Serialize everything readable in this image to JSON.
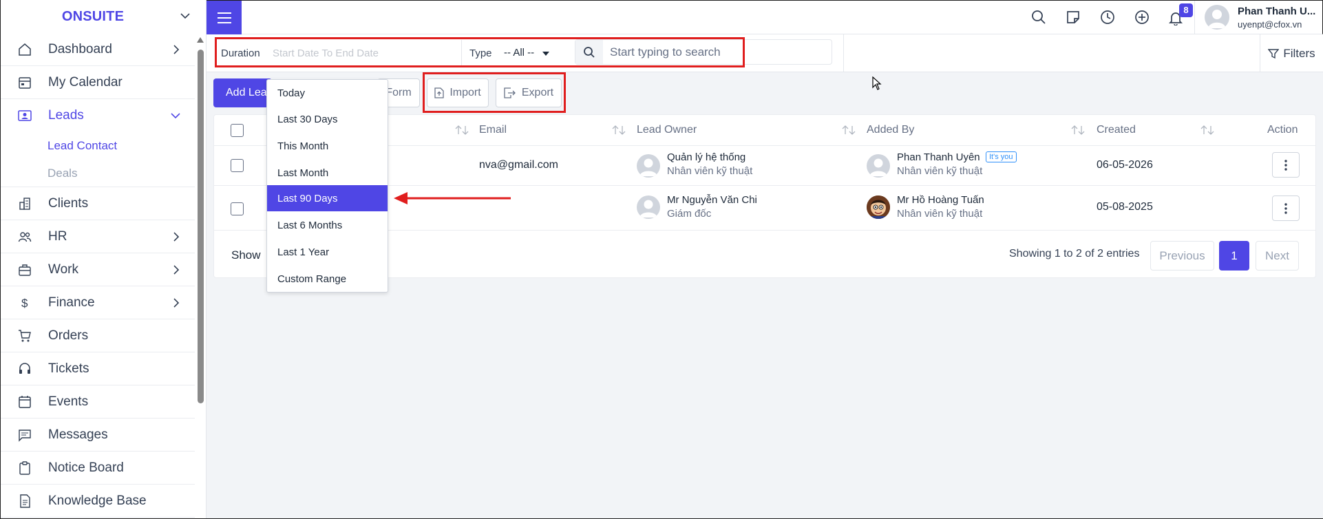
{
  "brand": {
    "name": "ONSUITE"
  },
  "sidebar": {
    "items": [
      {
        "label": "Dashboard",
        "icon": "home-icon",
        "has_arrow": true
      },
      {
        "label": "My Calendar",
        "icon": "calendar-icon",
        "has_arrow": false
      },
      {
        "label": "Leads",
        "icon": "leads-icon",
        "expanded": true
      },
      {
        "label": "Clients",
        "icon": "building-icon",
        "has_arrow": false
      },
      {
        "label": "HR",
        "icon": "people-icon",
        "has_arrow": true
      },
      {
        "label": "Work",
        "icon": "briefcase-icon",
        "has_arrow": true
      },
      {
        "label": "Finance",
        "icon": "dollar-icon",
        "has_arrow": true
      },
      {
        "label": "Orders",
        "icon": "cart-icon",
        "has_arrow": false
      },
      {
        "label": "Tickets",
        "icon": "headset-icon",
        "has_arrow": false
      },
      {
        "label": "Events",
        "icon": "event-icon",
        "has_arrow": false
      },
      {
        "label": "Messages",
        "icon": "message-icon",
        "has_arrow": false
      },
      {
        "label": "Notice Board",
        "icon": "clipboard-icon",
        "has_arrow": false
      },
      {
        "label": "Knowledge Base",
        "icon": "document-icon",
        "has_arrow": false
      }
    ],
    "leads_sub": [
      {
        "label": "Lead Contact",
        "active": true
      },
      {
        "label": "Deals",
        "active": false
      }
    ]
  },
  "topbar": {
    "notification_count": "8",
    "user_name": "Phan Thanh U...",
    "user_email": "uyenpt@cfox.vn"
  },
  "filters": {
    "duration_label": "Duration",
    "date_placeholder": "Start Date To End Date",
    "type_label": "Type",
    "type_value": "-- All --",
    "search_placeholder": "Start typing to search",
    "filters_label": "Filters"
  },
  "actions": {
    "add_label": "Add Lead",
    "form_label": "Form",
    "import_label": "Import",
    "export_label": "Export"
  },
  "table": {
    "columns": [
      "Email",
      "Lead Owner",
      "Added By",
      "Created",
      "Action"
    ],
    "rows": [
      {
        "email": "nva@gmail.com",
        "owner_name": "Quản lý hệ thống",
        "owner_role": "Nhân viên kỹ thuật",
        "added_name": "Phan Thanh Uyên",
        "added_badge": "It's you",
        "added_role": "Nhân viên kỹ thuật",
        "created": "06-05-2026"
      },
      {
        "email": "",
        "owner_name": "Mr Nguyễn Văn Chi",
        "owner_role": "Giám đốc",
        "added_name": "Mr Hồ Hoàng Tuấn",
        "added_badge": "",
        "added_role": "Nhân viên kỹ thuật",
        "created": "05-08-2025"
      }
    ],
    "show_label": "Show",
    "showing_text": "Showing 1 to 2 of 2 entries",
    "pagination": {
      "previous": "Previous",
      "current": "1",
      "next": "Next"
    }
  },
  "duration_dropdown": {
    "options": [
      "Today",
      "Last 30 Days",
      "This Month",
      "Last Month",
      "Last 90 Days",
      "Last 6 Months",
      "Last 1 Year",
      "Custom Range"
    ],
    "selected": "Last 90 Days"
  },
  "colors": {
    "accent": "#4f46e5",
    "highlight": "#e01e1e"
  }
}
